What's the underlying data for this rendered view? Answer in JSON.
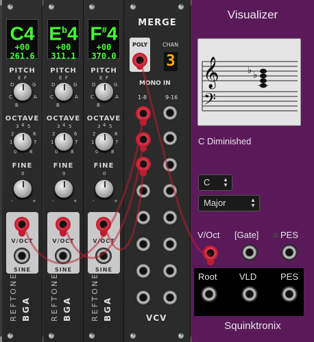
{
  "reftone_modules": [
    {
      "note": "C",
      "accidental": "",
      "octave": "4",
      "cents": "+00",
      "freq": "261.6"
    },
    {
      "note": "E",
      "accidental": "b",
      "octave": "4",
      "cents": "+00",
      "freq": "311.1"
    },
    {
      "note": "F",
      "accidental": "#",
      "octave": "4",
      "cents": "+00",
      "freq": "370.0"
    }
  ],
  "reftone_labels": {
    "pitch": "PITCH",
    "octave": "OCTAVE",
    "fine": "FINE",
    "voct": "V/OCT",
    "sine": "SINE",
    "name": "REFTONE",
    "brand": "BGA",
    "pitch_marks": [
      "E",
      "F",
      "D",
      "G",
      "C",
      "B",
      "A"
    ],
    "octave_marks": [
      "3",
      "4",
      "5",
      "2",
      "6",
      "1",
      "7",
      "0",
      "8"
    ],
    "fine_marks": [
      "0",
      "-",
      "+"
    ]
  },
  "merge": {
    "title": "MERGE",
    "poly_label": "POLY",
    "chan_label": "CHAN",
    "chan_value": "3",
    "mono_in_label": "MONO IN",
    "col1_label": "1-8",
    "col2_label": "9-16",
    "logo": "VCV"
  },
  "visualizer": {
    "title": "Visualizer",
    "chord_name": "C Diminished",
    "root_select": "C",
    "mode_select": "Major",
    "voct_label": "V/Oct",
    "gate_label": "[Gate]",
    "pes_in_label": "PES",
    "root_label": "Root",
    "vld_label": "VLD",
    "pes_out_label": "PES",
    "brand": "Squinktronix"
  },
  "colors": {
    "lcd_text": "#44ff33",
    "cable_red": "#c01c30",
    "visualizer_bg": "#5a1a5a",
    "chan_digit": "#ffb000"
  }
}
